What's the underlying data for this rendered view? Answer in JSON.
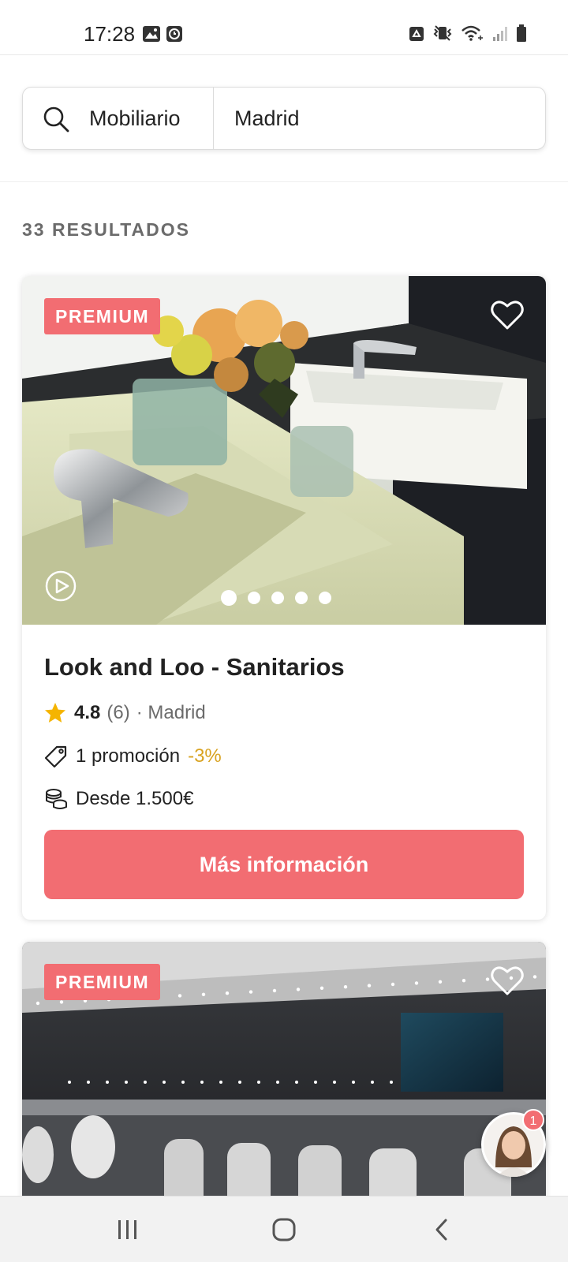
{
  "status_bar": {
    "time": "17:28",
    "left_icons": [
      "image-notification-icon",
      "clock-notification-icon"
    ],
    "right_icons": [
      "recycle-icon",
      "vibrate-icon",
      "wifi-icon",
      "signal-icon",
      "battery-icon"
    ]
  },
  "search": {
    "icon": "search-icon",
    "term": "Mobiliario",
    "location": "Madrid"
  },
  "results": {
    "count_label": "33 RESULTADOS"
  },
  "listings": [
    {
      "badge": "PREMIUM",
      "title": "Look and Loo - Sanitarios",
      "rating": "4.8",
      "review_count": "(6)",
      "location": "· Madrid",
      "promo_text": "1 promoción",
      "promo_discount": "-3%",
      "price": "Desde 1.500€",
      "cta": "Más información",
      "image_dots": 5,
      "active_dot": 0
    },
    {
      "badge": "PREMIUM"
    }
  ],
  "chat": {
    "badge_count": "1"
  },
  "nav": {
    "buttons": [
      "recent-apps",
      "home",
      "back"
    ]
  },
  "colors": {
    "accent": "#f26d72",
    "discount": "#d9a321",
    "muted_text": "#6b6b6b"
  }
}
